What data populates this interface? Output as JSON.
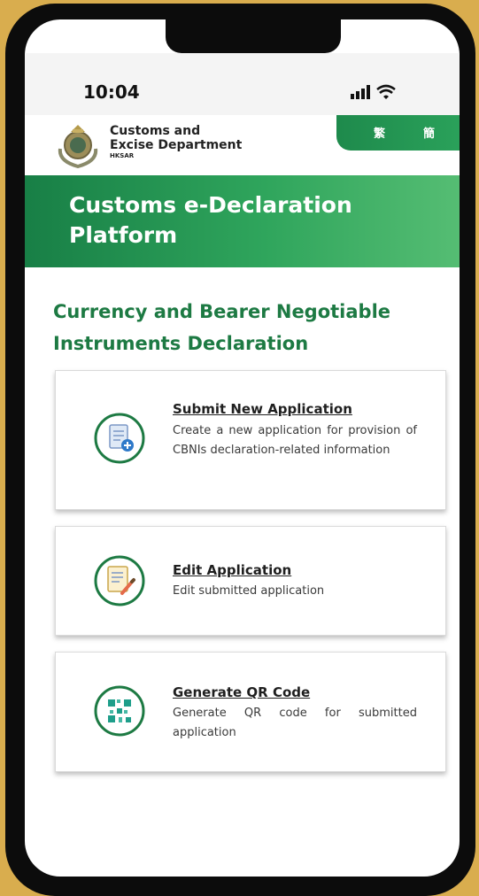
{
  "status_bar": {
    "time": "10:04"
  },
  "header": {
    "dept_line1": "Customs and",
    "dept_line2": "Excise Department",
    "dept_line3": "HKSAR",
    "lang_traditional": "繁",
    "lang_simplified": "簡"
  },
  "banner": {
    "title": "Customs e-Declaration Platform"
  },
  "page": {
    "section_title": "Currency and Bearer Negotiable Instruments Declaration"
  },
  "cards": [
    {
      "title": "Submit New Application",
      "description": "Create a new application for provision of CBNIs declaration-related information",
      "icon": "new-document-icon"
    },
    {
      "title": "Edit Application",
      "description": "Edit submitted application",
      "icon": "edit-document-icon"
    },
    {
      "title": "Generate QR Code",
      "description": "Generate QR code for submitted application",
      "icon": "qr-code-icon"
    }
  ],
  "colors": {
    "brand_green": "#1d7a43",
    "banner_green": "#2fa55c",
    "background_gold": "#d9ad4e"
  }
}
